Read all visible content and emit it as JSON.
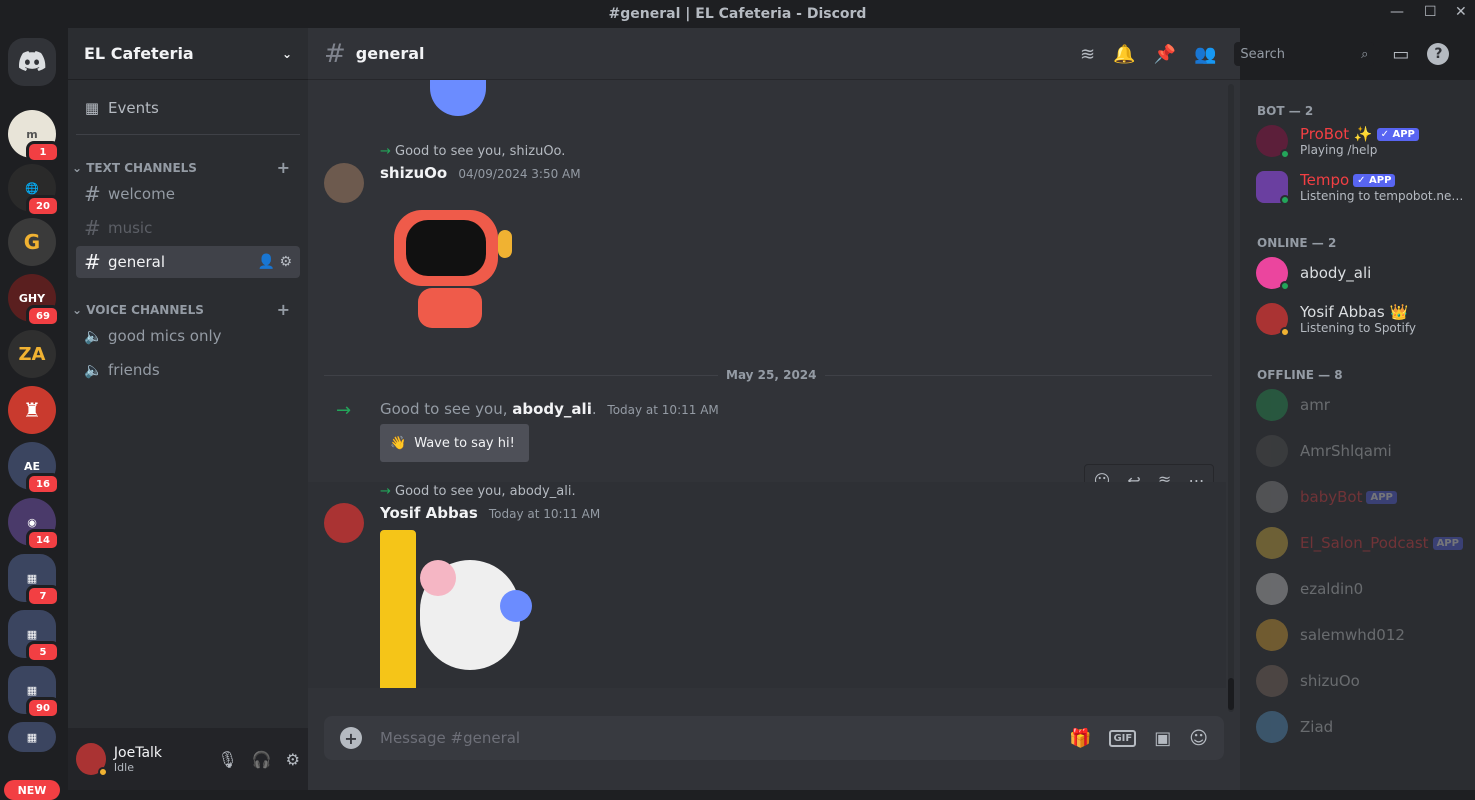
{
  "window": {
    "title": "#general | EL Cafeteria - Discord"
  },
  "servers": [
    {
      "badge": "1",
      "color": "#e8e4d8"
    },
    {
      "badge": "20",
      "color": "#2a2a2a"
    },
    {
      "badge": "",
      "color": "#3a3a3a"
    },
    {
      "badge": "69",
      "color": "#5a1f1f"
    },
    {
      "badge": "",
      "color": "#2f2f2f"
    },
    {
      "badge": "",
      "color": "#c93a2e"
    },
    {
      "badge": "16",
      "color": "#3b4560"
    },
    {
      "badge": "14",
      "color": "#4a3a6a"
    },
    {
      "badge": "7",
      "color": "#3b4560"
    },
    {
      "badge": "5",
      "color": "#3b4560"
    },
    {
      "badge": "90",
      "color": "#3b4560"
    },
    {
      "badge": "",
      "color": "#3b4560"
    }
  ],
  "new_label": "NEW",
  "guild": {
    "name": "EL Cafeteria",
    "events_label": "Events"
  },
  "text_category": "TEXT CHANNELS",
  "voice_category": "VOICE CHANNELS",
  "text_channels": [
    "welcome",
    "music",
    "general"
  ],
  "voice_channels": [
    "good mics only",
    "friends"
  ],
  "user": {
    "name": "JoeTalk",
    "status": "Idle"
  },
  "channel": {
    "name": "general",
    "search_placeholder": "Search",
    "composer_placeholder": "Message #general"
  },
  "messages": {
    "m1": {
      "reply": "Good to see you, shizuOo.",
      "author": "shizuOo",
      "timestamp": "04/09/2024 3:50 AM"
    },
    "date_divider": "May 25, 2024",
    "m2": {
      "pre": "Good to see you,",
      "author": "abody_ali",
      "post": ".",
      "timestamp": "Today at 10:11 AM",
      "button": "Wave to say hi!"
    },
    "m3": {
      "reply": "Good to see you, abody_ali.",
      "author": "Yosif Abbas",
      "timestamp": "Today at 10:11 AM"
    }
  },
  "members": {
    "bot_header": "BOT — 2",
    "online_header": "ONLINE — 2",
    "offline_header": "OFFLINE — 8",
    "bots": [
      {
        "name": "ProBot ✨",
        "tag": "✓ APP",
        "activity": "Playing /help",
        "color": "#f23f43"
      },
      {
        "name": "Tempo",
        "tag": "✓ APP",
        "activity": "Listening to tempobot.net | /p...",
        "color": "#f23f43"
      }
    ],
    "online": [
      {
        "name": "abody_ali",
        "activity": ""
      },
      {
        "name": "Yosif Abbas 👑",
        "activity": "Listening to Spotify"
      }
    ],
    "offline": [
      {
        "name": "amr",
        "tag": ""
      },
      {
        "name": "AmrShlqami",
        "tag": ""
      },
      {
        "name": "babyBot",
        "tag": "APP"
      },
      {
        "name": "El_Salon_Podcast",
        "tag": "APP"
      },
      {
        "name": "ezaldin0",
        "tag": ""
      },
      {
        "name": "salemwhd012",
        "tag": ""
      },
      {
        "name": "shizuOo",
        "tag": ""
      },
      {
        "name": "Ziad",
        "tag": ""
      }
    ]
  }
}
